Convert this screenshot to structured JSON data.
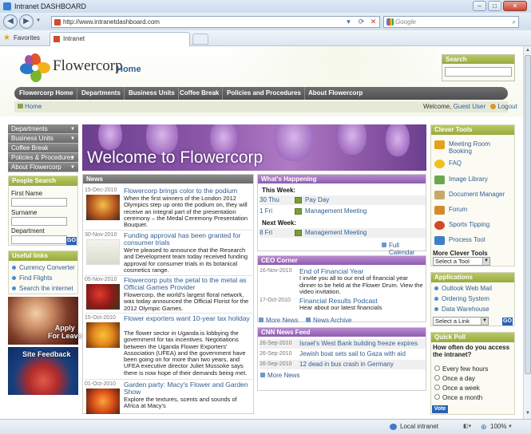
{
  "window": {
    "title": "Intranet DASHBOARD",
    "min": "–",
    "max": "□",
    "close": "✕"
  },
  "browser": {
    "url": "http://www.intranetdashboard.com",
    "search_placeholder": "Google",
    "favorites_label": "Favorites",
    "tab_label": "Intranet",
    "status_zone": "Local intranet",
    "zoom": "100%"
  },
  "header": {
    "logo_text": "Flowercorp",
    "page_title": "Home",
    "search_title": "Search",
    "nav": [
      "Flowercorp Home",
      "Departments",
      "Business Units",
      "Coffee Break",
      "Policies and Procedures",
      "About Flowercorp"
    ],
    "breadcrumb_home": "Home",
    "welcome_prefix": "Welcome,",
    "user": "Guest User",
    "logout": "Logout"
  },
  "left": {
    "nav": [
      {
        "label": "Departments",
        "arrow": "▼"
      },
      {
        "label": "Business Units",
        "arrow": "▼"
      },
      {
        "label": "Coffee Break",
        "arrow": ""
      },
      {
        "label": "Policies & Procedures",
        "arrow": "▼"
      },
      {
        "label": "About Flowercorp",
        "arrow": "▼"
      }
    ],
    "people_search": {
      "title": "People Search",
      "first": "First Name",
      "surname": "Surname",
      "department": "Department",
      "go": "GO"
    },
    "useful": {
      "title": "Useful links",
      "items": [
        "Currency Converter",
        "Find Flights",
        "Search the internet"
      ]
    },
    "promo1": "Apply\nFor Leave",
    "promo2": "Site Feedback"
  },
  "hero_title": "Welcome to Flowercorp",
  "news": {
    "title": "News",
    "items": [
      {
        "date": "15-Dec-2010",
        "title": "Flowercorp brings color to the podium",
        "body": "When the first winners of the London 2012 Olympics step up onto the podium on, they will receive an integral part of the presentation ceremony – the Medal Ceremony Presentation Bouquet."
      },
      {
        "date": "30-Nov-2010",
        "title": "Funding approval has been granted for consumer trials",
        "body": "We're pleased to announce that the Research and Development team today received funding approval for consumer trials in its botanical cosmetics range."
      },
      {
        "date": "05-Nov-2010",
        "title": "Flowercorp puts the petal to the metal as Official Games Provider",
        "body": "Flowercorp, the world's largest floral network, was today announced the Official Florist for the 2012 Olympic Games."
      },
      {
        "date": "15-Oct-2010",
        "title": "Flower exporters want 10-year tax holiday",
        "body": "The flower sector in Uganda is lobbying the government for tax incentives. Negotiations between the Uganda Flower Exporters' Association (UFEA) and the government have been going on for more than two years, and UFEA executive director Juliet Mussoke says there is now hope of their demands being met."
      },
      {
        "date": "01-Oct-2010",
        "title": "Garden party: Macy's Flower and Garden Show",
        "body": "Explore the textures, scents and sounds of Africa at Macy's"
      }
    ]
  },
  "whats_happening": {
    "title": "What's Happening",
    "this_week": "This Week:",
    "next_week": "Next Week:",
    "this": [
      {
        "date": "30 Thu",
        "title": "Pay Day"
      },
      {
        "date": "1 Fri",
        "title": "Management Meeting"
      }
    ],
    "next": [
      {
        "date": "8 Fri",
        "title": "Management Meeting"
      }
    ],
    "more": "Full Calendar"
  },
  "ceo": {
    "title": "CEO Corner",
    "items": [
      {
        "date": "16-Nov-2010",
        "title": "End of Financial Year",
        "body": "I invite you all to our end of financial year dinner to be held at the Flower Drum. View the video invitation."
      },
      {
        "date": "17-Oct-2010",
        "title": "Financial Results Podcast",
        "body": "Hear about our latest financials"
      }
    ],
    "more_news": "More News",
    "news_archive": "News Archive"
  },
  "cnn": {
    "title": "CNN News Feed",
    "items": [
      {
        "date": "26-Sep-2010",
        "title": "Israel's West Bank building freeze expires"
      },
      {
        "date": "26-Sep-2010",
        "title": "Jewish boat sets sail to Gaza with aid"
      },
      {
        "date": "26-Sep-2010",
        "title": "12 dead in bus crash in Germany"
      }
    ],
    "more": "More News"
  },
  "clever_tools": {
    "title": "Clever Tools",
    "items": [
      "Meeting Room Booking",
      "FAQ",
      "Image Library",
      "Document Manager",
      "Forum",
      "Sports Tipping",
      "Process Tool"
    ],
    "more_label": "More Clever Tools",
    "select": "Select a Tool"
  },
  "applications": {
    "title": "Applications",
    "items": [
      "Outlook Web Mail",
      "Ordering System",
      "Data Warehouse"
    ],
    "select": "Select a Link",
    "go": "GO"
  },
  "poll": {
    "title": "Quick Poll",
    "question": "How often do you access the intranet?",
    "options": [
      "Every few hours",
      "Once a day",
      "Once a week",
      "Once a month"
    ],
    "vote": "Vote"
  }
}
